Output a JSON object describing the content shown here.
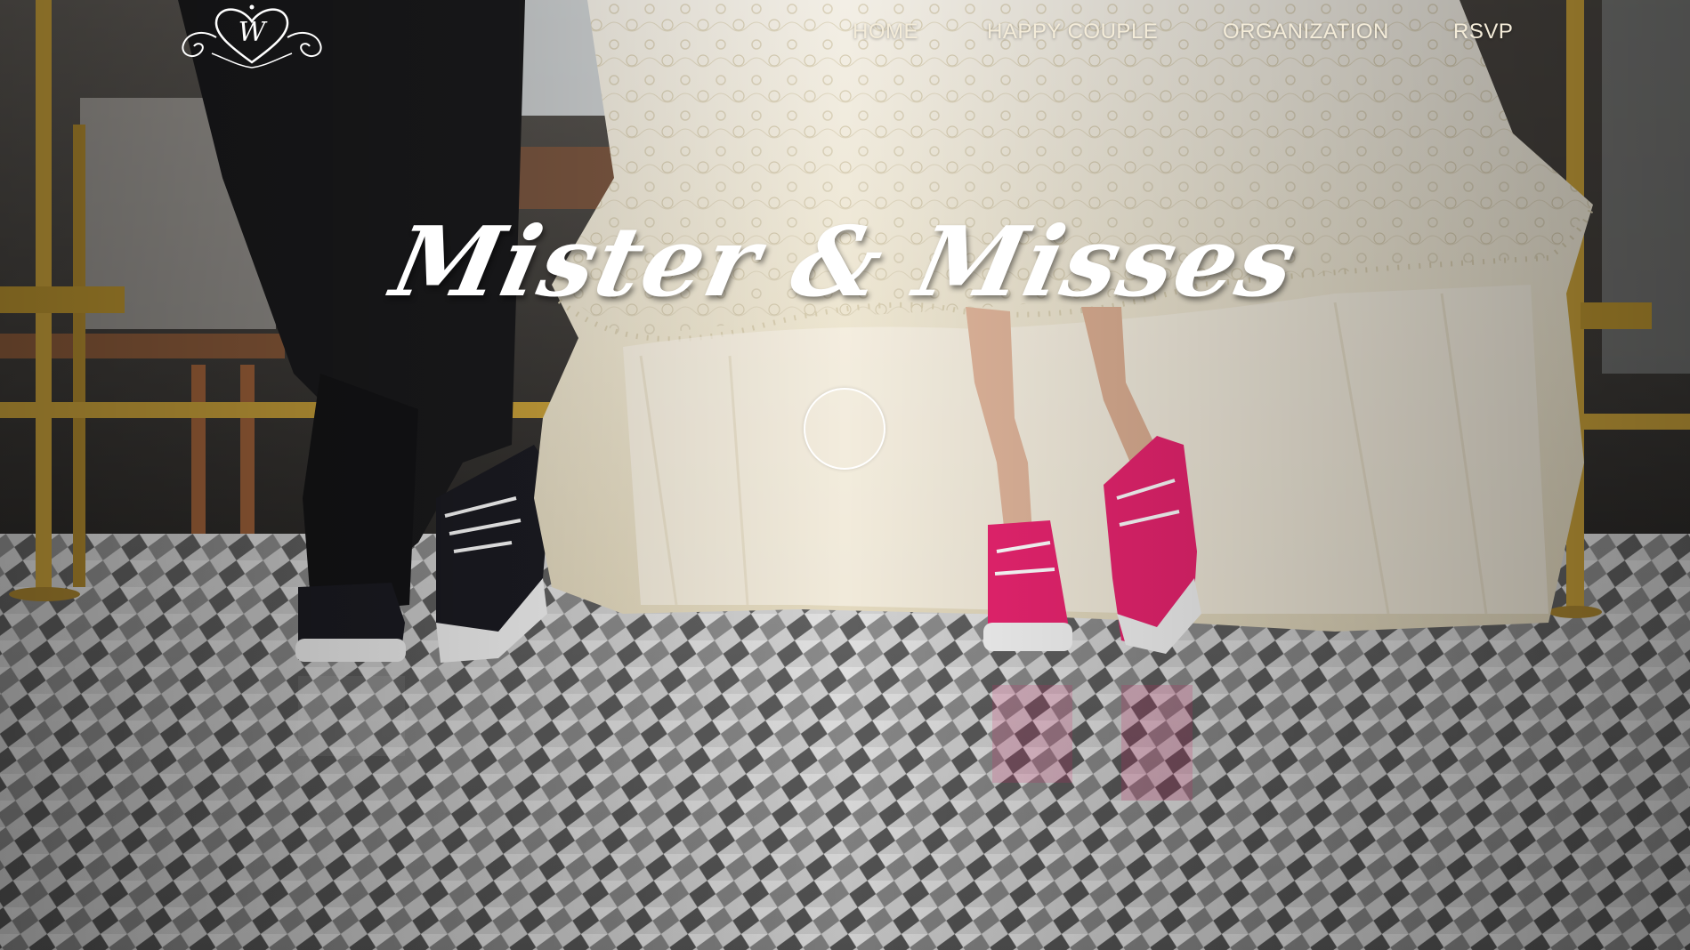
{
  "logo": {
    "letter": "W",
    "icon": "ornate-monogram-logo"
  },
  "nav": {
    "home": "HOME",
    "happy_couple": "HAPPY COUPLE",
    "organization": "ORGANIZATION",
    "rsvp": "RSVP"
  },
  "hero": {
    "title": "Mister & Misses",
    "play_icon": "circle-ring-icon"
  },
  "colors": {
    "nav_text": "#f4ecd9",
    "title_text": "#ffffff",
    "dress": "#efe9d6",
    "shoe_pink": "#e8246f",
    "shoe_black": "#1b1b22",
    "brass": "#c9a13a"
  }
}
